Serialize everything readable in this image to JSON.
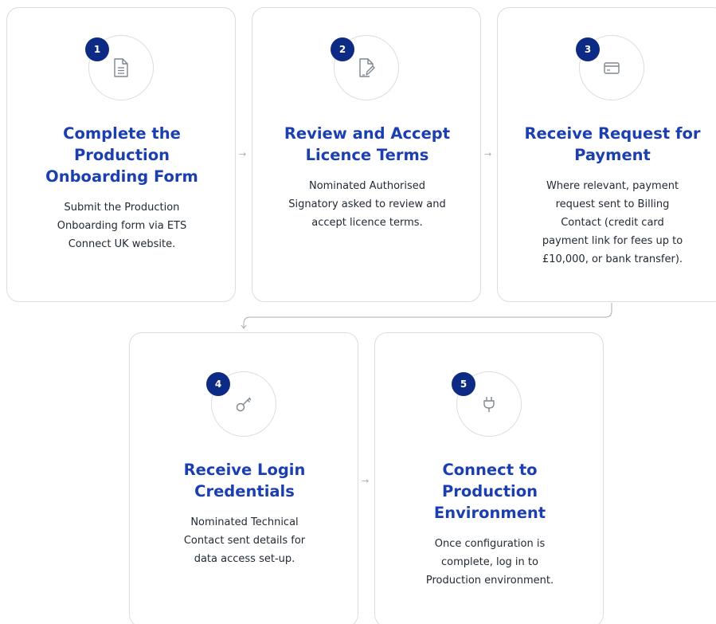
{
  "steps": [
    {
      "number": "1",
      "icon": "document-icon",
      "title_lines": [
        "Complete the",
        "Production",
        "Onboarding Form"
      ],
      "desc_lines": [
        "Submit the Production",
        "Onboarding form via ETS",
        "Connect UK website."
      ]
    },
    {
      "number": "2",
      "icon": "sign-document-icon",
      "title_lines": [
        "Review and Accept",
        "Licence Terms"
      ],
      "desc_lines": [
        "Nominated Authorised",
        "Signatory asked to review and",
        "accept licence terms."
      ]
    },
    {
      "number": "3",
      "icon": "credit-card-icon",
      "title_lines": [
        "Receive Request for",
        "Payment"
      ],
      "desc_lines": [
        "Where relevant, payment",
        "request sent to Billing",
        "Contact (credit card",
        "payment link for fees up to",
        "£10,000, or bank transfer)."
      ]
    },
    {
      "number": "4",
      "icon": "key-icon",
      "title_lines": [
        "Receive Login",
        "Credentials"
      ],
      "desc_lines": [
        "Nominated Technical",
        "Contact sent details for",
        "data access set-up."
      ]
    },
    {
      "number": "5",
      "icon": "plug-icon",
      "title_lines": [
        "Connect to",
        "Production",
        "Environment"
      ],
      "desc_lines": [
        "Once configuration is",
        "complete, log in to",
        "Production environment."
      ]
    }
  ],
  "arrow_glyph": "→",
  "colors": {
    "badge": "#0d2a84",
    "title": "#1c3fb0",
    "border": "#d9dde3",
    "text": "#222a33",
    "arrow": "#a8adb5"
  }
}
